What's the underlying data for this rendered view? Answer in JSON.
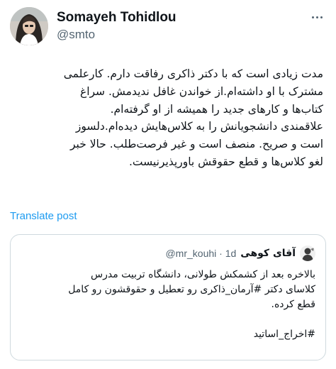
{
  "author": {
    "display_name": "Somayeh Tohidlou",
    "handle": "@smto"
  },
  "tweet": {
    "lines": [
      "مدت زیادی است که با دکتر ذاکری رفاقت دارم. کارعلمی",
      "مشترک با او داشته‌ام.از خواندن غافل ندیدمش. سراغ",
      "کتاب‌ها و کارهای جدید را همیشه از او گرفته‌ام.",
      "علاقمندی دانشجویانش را به کلاس‌هایش دیده‌ام.دلسوز",
      "است و صریح. منصف است و غیر فرصت‌طلب. حالا خبر",
      "لغو کلاس‌ها و قطع حقوقش باورپذیرنیست."
    ]
  },
  "translate_label": "Translate post",
  "quoted": {
    "display_name": "آقای کوهی",
    "meta": "@mr_kouhi · 1d",
    "lines": [
      "بالاخره بعد از کشمکش طولانی، دانشگاه تربیت مدرس",
      "کلاسای دکتر #آرمان_ذاکری رو تعطیل و حقوقشون رو کامل",
      "قطع کرده."
    ],
    "hashtag_line": "#اخراج_اساتید"
  },
  "icons": {
    "more": "more-horizontal-icon"
  },
  "colors": {
    "link": "#1d9bf0",
    "secondary_text": "#536471",
    "border": "#cfd9de"
  }
}
